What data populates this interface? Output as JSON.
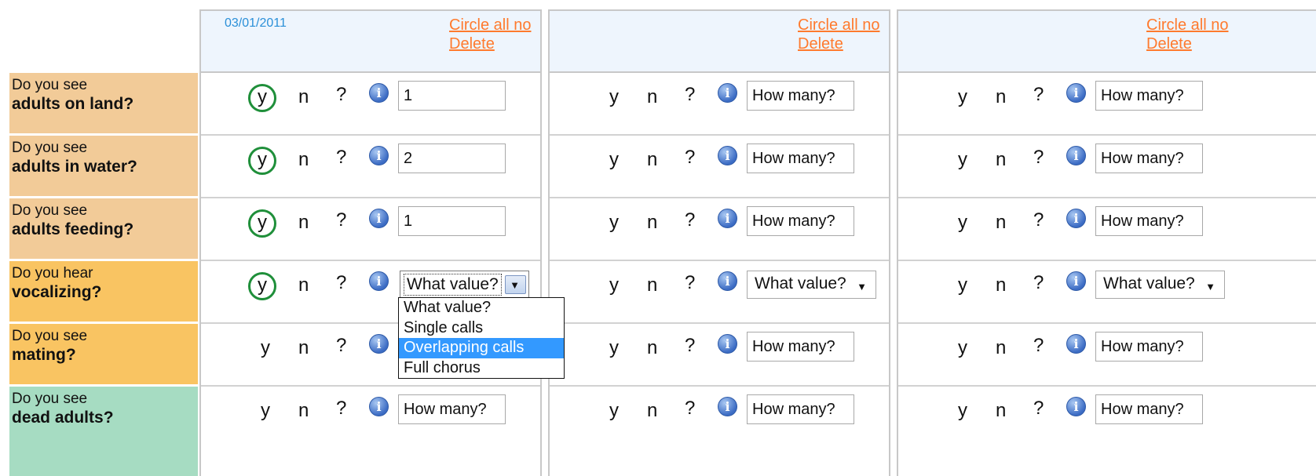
{
  "columns": [
    {
      "date": "03/01/2011",
      "circle_all_no": "Circle all no",
      "delete": "Delete"
    },
    {
      "date": "",
      "circle_all_no": "Circle all no",
      "delete": "Delete"
    },
    {
      "date": "",
      "circle_all_no": "Circle all no",
      "delete": "Delete"
    }
  ],
  "questions": [
    {
      "prefix": "Do you see",
      "subject": "adults on land?",
      "bg_color": "#f2cb98",
      "input": "text"
    },
    {
      "prefix": "Do you see",
      "subject": "adults in water?",
      "bg_color": "#f2cb98",
      "input": "text"
    },
    {
      "prefix": "Do you see",
      "subject": "adults feeding?",
      "bg_color": "#f2cb98",
      "input": "text"
    },
    {
      "prefix": "Do you hear",
      "subject": "vocalizing?",
      "bg_color": "#f9c462",
      "input": "select"
    },
    {
      "prefix": "Do you see",
      "subject": "mating?",
      "bg_color": "#f9c462",
      "input": "text"
    },
    {
      "prefix": "Do you see",
      "subject": "dead adults?",
      "bg_color": "#a6dcc2",
      "input": "text"
    }
  ],
  "answer_labels": {
    "yes": "y",
    "no": "n",
    "unknown": "?",
    "info": "i"
  },
  "placeholders": {
    "count": "How many?",
    "value": "What value?"
  },
  "column1_answers": {
    "row1": {
      "selected": "y",
      "value": "1"
    },
    "row2": {
      "selected": "y",
      "value": "2"
    },
    "row3": {
      "selected": "y",
      "value": "1"
    },
    "row4": {
      "selected": "y",
      "value": "What value?"
    }
  },
  "vocalizing_dropdown": {
    "options": [
      "What value?",
      "Single calls",
      "Overlapping calls",
      "Full chorus"
    ],
    "highlighted": "Overlapping calls"
  },
  "colors": {
    "circle": "#1f8f3a",
    "link": "#ff7a2d",
    "date": "#2a8fd8",
    "header_bg": "#eef5fd",
    "highlight": "#3399ff"
  }
}
